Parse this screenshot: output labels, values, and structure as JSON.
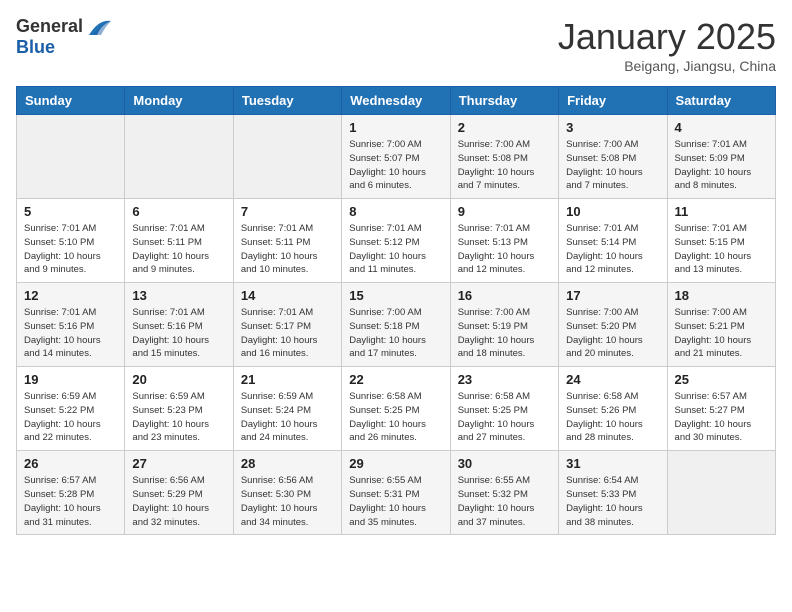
{
  "logo": {
    "general": "General",
    "blue": "Blue"
  },
  "title": "January 2025",
  "location": "Beigang, Jiangsu, China",
  "days_of_week": [
    "Sunday",
    "Monday",
    "Tuesday",
    "Wednesday",
    "Thursday",
    "Friday",
    "Saturday"
  ],
  "weeks": [
    [
      {
        "day": "",
        "info": ""
      },
      {
        "day": "",
        "info": ""
      },
      {
        "day": "",
        "info": ""
      },
      {
        "day": "1",
        "info": "Sunrise: 7:00 AM\nSunset: 5:07 PM\nDaylight: 10 hours\nand 6 minutes."
      },
      {
        "day": "2",
        "info": "Sunrise: 7:00 AM\nSunset: 5:08 PM\nDaylight: 10 hours\nand 7 minutes."
      },
      {
        "day": "3",
        "info": "Sunrise: 7:00 AM\nSunset: 5:08 PM\nDaylight: 10 hours\nand 7 minutes."
      },
      {
        "day": "4",
        "info": "Sunrise: 7:01 AM\nSunset: 5:09 PM\nDaylight: 10 hours\nand 8 minutes."
      }
    ],
    [
      {
        "day": "5",
        "info": "Sunrise: 7:01 AM\nSunset: 5:10 PM\nDaylight: 10 hours\nand 9 minutes."
      },
      {
        "day": "6",
        "info": "Sunrise: 7:01 AM\nSunset: 5:11 PM\nDaylight: 10 hours\nand 9 minutes."
      },
      {
        "day": "7",
        "info": "Sunrise: 7:01 AM\nSunset: 5:11 PM\nDaylight: 10 hours\nand 10 minutes."
      },
      {
        "day": "8",
        "info": "Sunrise: 7:01 AM\nSunset: 5:12 PM\nDaylight: 10 hours\nand 11 minutes."
      },
      {
        "day": "9",
        "info": "Sunrise: 7:01 AM\nSunset: 5:13 PM\nDaylight: 10 hours\nand 12 minutes."
      },
      {
        "day": "10",
        "info": "Sunrise: 7:01 AM\nSunset: 5:14 PM\nDaylight: 10 hours\nand 12 minutes."
      },
      {
        "day": "11",
        "info": "Sunrise: 7:01 AM\nSunset: 5:15 PM\nDaylight: 10 hours\nand 13 minutes."
      }
    ],
    [
      {
        "day": "12",
        "info": "Sunrise: 7:01 AM\nSunset: 5:16 PM\nDaylight: 10 hours\nand 14 minutes."
      },
      {
        "day": "13",
        "info": "Sunrise: 7:01 AM\nSunset: 5:16 PM\nDaylight: 10 hours\nand 15 minutes."
      },
      {
        "day": "14",
        "info": "Sunrise: 7:01 AM\nSunset: 5:17 PM\nDaylight: 10 hours\nand 16 minutes."
      },
      {
        "day": "15",
        "info": "Sunrise: 7:00 AM\nSunset: 5:18 PM\nDaylight: 10 hours\nand 17 minutes."
      },
      {
        "day": "16",
        "info": "Sunrise: 7:00 AM\nSunset: 5:19 PM\nDaylight: 10 hours\nand 18 minutes."
      },
      {
        "day": "17",
        "info": "Sunrise: 7:00 AM\nSunset: 5:20 PM\nDaylight: 10 hours\nand 20 minutes."
      },
      {
        "day": "18",
        "info": "Sunrise: 7:00 AM\nSunset: 5:21 PM\nDaylight: 10 hours\nand 21 minutes."
      }
    ],
    [
      {
        "day": "19",
        "info": "Sunrise: 6:59 AM\nSunset: 5:22 PM\nDaylight: 10 hours\nand 22 minutes."
      },
      {
        "day": "20",
        "info": "Sunrise: 6:59 AM\nSunset: 5:23 PM\nDaylight: 10 hours\nand 23 minutes."
      },
      {
        "day": "21",
        "info": "Sunrise: 6:59 AM\nSunset: 5:24 PM\nDaylight: 10 hours\nand 24 minutes."
      },
      {
        "day": "22",
        "info": "Sunrise: 6:58 AM\nSunset: 5:25 PM\nDaylight: 10 hours\nand 26 minutes."
      },
      {
        "day": "23",
        "info": "Sunrise: 6:58 AM\nSunset: 5:25 PM\nDaylight: 10 hours\nand 27 minutes."
      },
      {
        "day": "24",
        "info": "Sunrise: 6:58 AM\nSunset: 5:26 PM\nDaylight: 10 hours\nand 28 minutes."
      },
      {
        "day": "25",
        "info": "Sunrise: 6:57 AM\nSunset: 5:27 PM\nDaylight: 10 hours\nand 30 minutes."
      }
    ],
    [
      {
        "day": "26",
        "info": "Sunrise: 6:57 AM\nSunset: 5:28 PM\nDaylight: 10 hours\nand 31 minutes."
      },
      {
        "day": "27",
        "info": "Sunrise: 6:56 AM\nSunset: 5:29 PM\nDaylight: 10 hours\nand 32 minutes."
      },
      {
        "day": "28",
        "info": "Sunrise: 6:56 AM\nSunset: 5:30 PM\nDaylight: 10 hours\nand 34 minutes."
      },
      {
        "day": "29",
        "info": "Sunrise: 6:55 AM\nSunset: 5:31 PM\nDaylight: 10 hours\nand 35 minutes."
      },
      {
        "day": "30",
        "info": "Sunrise: 6:55 AM\nSunset: 5:32 PM\nDaylight: 10 hours\nand 37 minutes."
      },
      {
        "day": "31",
        "info": "Sunrise: 6:54 AM\nSunset: 5:33 PM\nDaylight: 10 hours\nand 38 minutes."
      },
      {
        "day": "",
        "info": ""
      }
    ]
  ]
}
